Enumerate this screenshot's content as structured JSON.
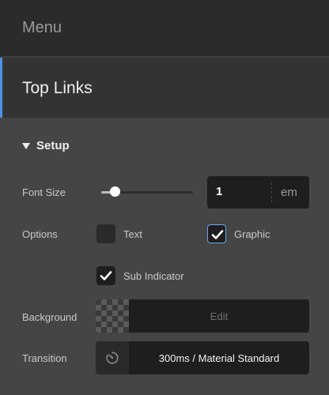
{
  "header": {
    "title": "Menu"
  },
  "panel": {
    "title": "Top Links"
  },
  "setup": {
    "section_title": "Setup",
    "font_size": {
      "label": "Font Size",
      "slider_level": 0.15,
      "value": "1",
      "unit": "em"
    },
    "options": {
      "label": "Options",
      "items": [
        {
          "label": "Text",
          "checked": false
        },
        {
          "label": "Graphic",
          "checked": true
        },
        {
          "label": "Sub Indicator",
          "checked": true
        }
      ]
    },
    "background": {
      "label": "Background",
      "button": "Edit"
    },
    "transition": {
      "label": "Transition",
      "value": "300ms / Material Standard"
    }
  },
  "colors": {
    "accent": "#4f8fe6",
    "panel_bg": "#454545",
    "field_bg": "#1e1e1e"
  },
  "icons": {
    "section_toggle": "caret-down-icon",
    "checkmark": "checkmark-icon",
    "transition": "timer-icon"
  }
}
